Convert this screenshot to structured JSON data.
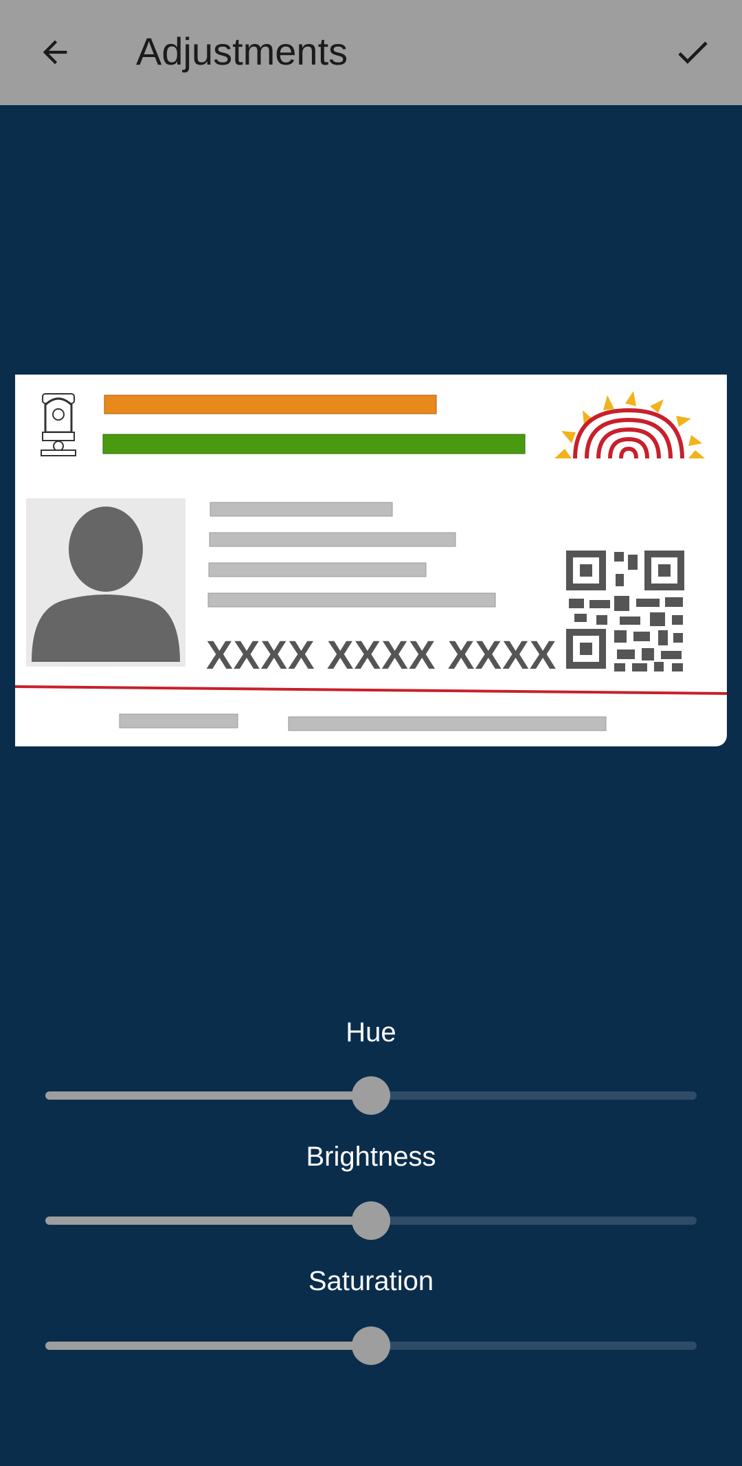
{
  "appbar": {
    "title": "Adjustments",
    "back_icon": "arrow-back-icon",
    "confirm_icon": "check-icon"
  },
  "card": {
    "aadhaar_number": "XXXX XXXX XXXX"
  },
  "sliders": [
    {
      "label": "Hue",
      "value": 0.5
    },
    {
      "label": "Brightness",
      "value": 0.5
    },
    {
      "label": "Saturation",
      "value": 0.5
    }
  ],
  "colors": {
    "appbar": "#9e9e9e",
    "background": "#0b2d4c",
    "slider_active": "#9e9e9e",
    "slider_inactive": "#2e4c68"
  }
}
